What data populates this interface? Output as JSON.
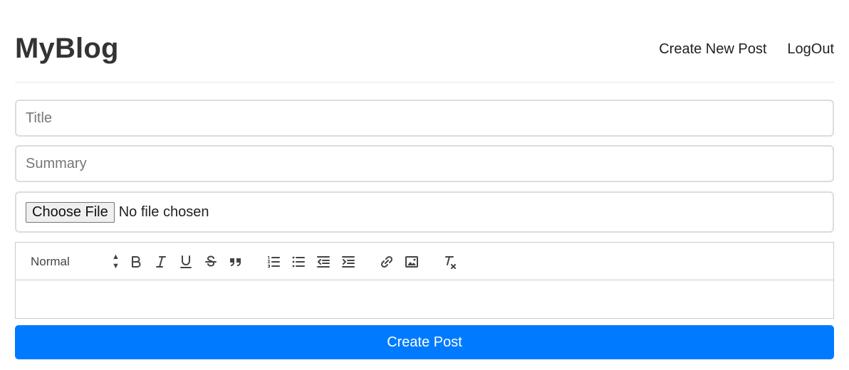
{
  "header": {
    "logo": "MyBlog",
    "nav": [
      {
        "label": "Create New Post"
      },
      {
        "label": "LogOut"
      }
    ]
  },
  "form": {
    "title_placeholder": "Title",
    "summary_placeholder": "Summary",
    "file_button_label": "Choose File",
    "file_status": "No file chosen",
    "editor": {
      "format_value": "Normal",
      "toolbar_icons": [
        "bold-icon",
        "italic-icon",
        "underline-icon",
        "strike-icon",
        "blockquote-icon",
        "ordered-list-icon",
        "bullet-list-icon",
        "outdent-icon",
        "indent-icon",
        "link-icon",
        "image-icon",
        "clear-format-icon"
      ]
    },
    "submit_label": "Create Post"
  },
  "colors": {
    "primary": "#007bff",
    "logo_text": "#333333",
    "border": "#dcdcdc"
  }
}
